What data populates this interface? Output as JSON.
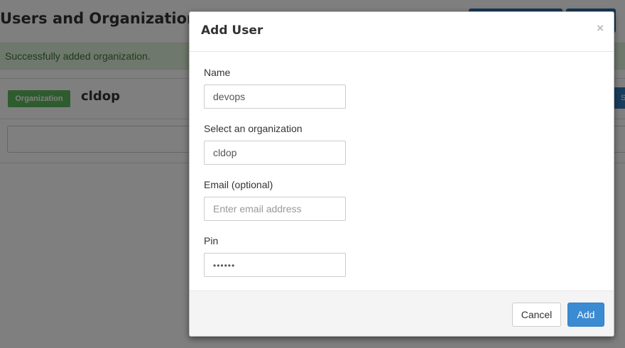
{
  "page": {
    "title": "Users and Organizations",
    "alert": "Successfully added organization.",
    "org_badge": "Organization",
    "org_name": "cldop",
    "org_button_partial": "S"
  },
  "modal": {
    "title": "Add User",
    "close_label": "×",
    "fields": {
      "name": {
        "label": "Name",
        "value": "devops"
      },
      "organization": {
        "label": "Select an organization",
        "value": "cldop"
      },
      "email": {
        "label": "Email (optional)",
        "value": "",
        "placeholder": "Enter email address"
      },
      "pin": {
        "label": "Pin",
        "value": "••••••"
      }
    },
    "cancel_label": "Cancel",
    "add_label": "Add"
  },
  "colors": {
    "primary": "#337ab7",
    "success": "#5cb85c",
    "alert_bg": "#dff0d8",
    "alert_text": "#3c763d",
    "add_button": "#3b8bd3"
  }
}
